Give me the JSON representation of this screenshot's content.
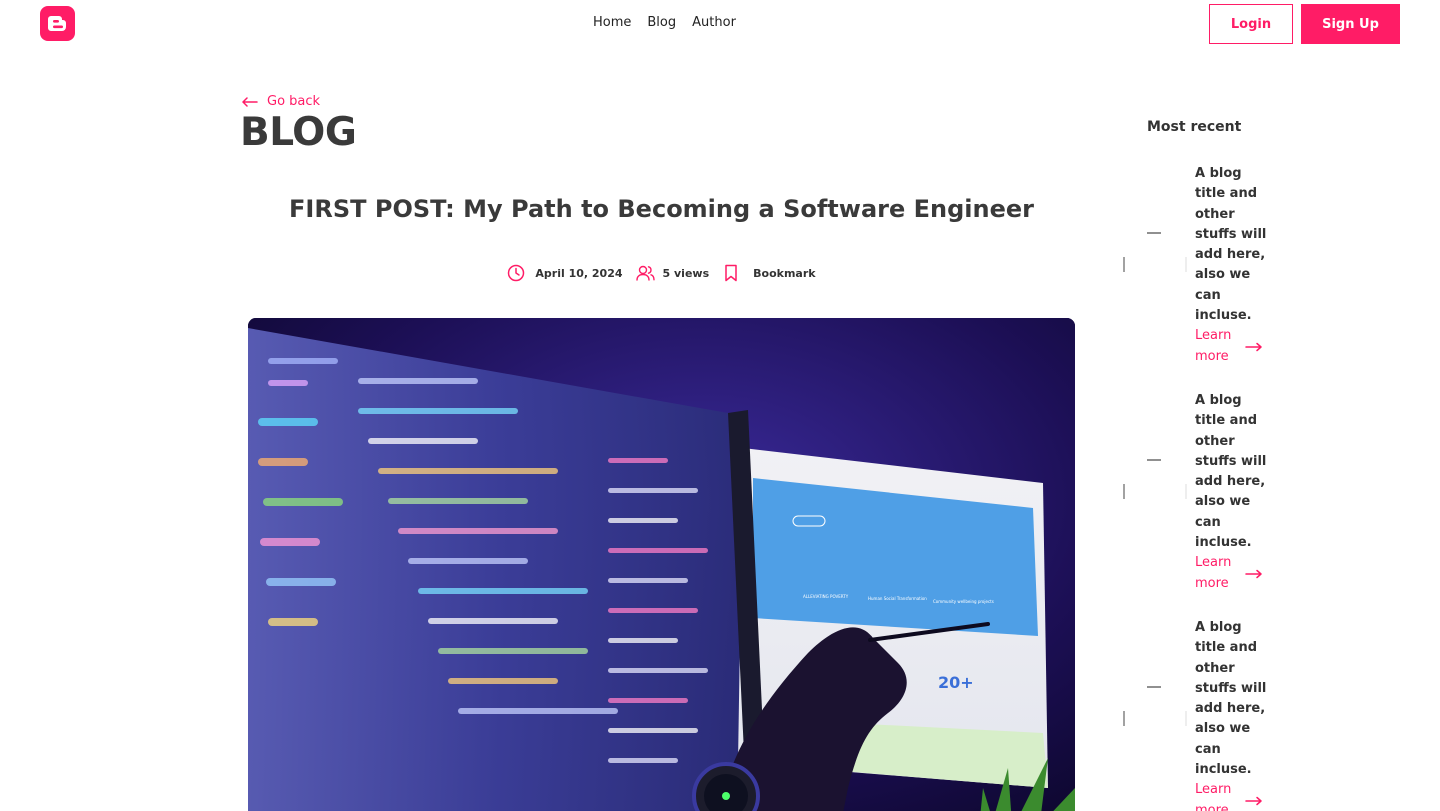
{
  "header": {
    "logo_icon": "blogger-b-icon",
    "nav": [
      {
        "label": "Home"
      },
      {
        "label": "Blog"
      },
      {
        "label": "Author"
      }
    ],
    "login_label": "Login",
    "signup_label": "Sign Up"
  },
  "page": {
    "go_back_label": "Go back",
    "heading": "BLOG"
  },
  "post": {
    "title": "FIRST POST: My Path to Becoming a Software Engineer",
    "date": "April 10, 2024",
    "views": "5 views",
    "bookmark_label": "Bookmark",
    "image_alt": "photo-of-code-on-monitor-with-hand-pointing",
    "screen_text_large": "20+",
    "screen_captions": [
      "ALLEVIATING POVERTY",
      "Human Social Transformation",
      "Community wellbeing projects"
    ]
  },
  "sidebar": {
    "title": "Most recent",
    "items": [
      {
        "title": "A blog title and other stuffs will add here, also we can incluse.",
        "link_label": "Learn more"
      },
      {
        "title": "A blog title and other stuffs will add here, also we can incluse.",
        "link_label": "Learn more"
      },
      {
        "title": "A blog title and other stuffs will add here, also we can incluse.",
        "link_label": "Learn more"
      }
    ]
  },
  "colors": {
    "accent": "#ff1c66",
    "text": "#333333"
  }
}
